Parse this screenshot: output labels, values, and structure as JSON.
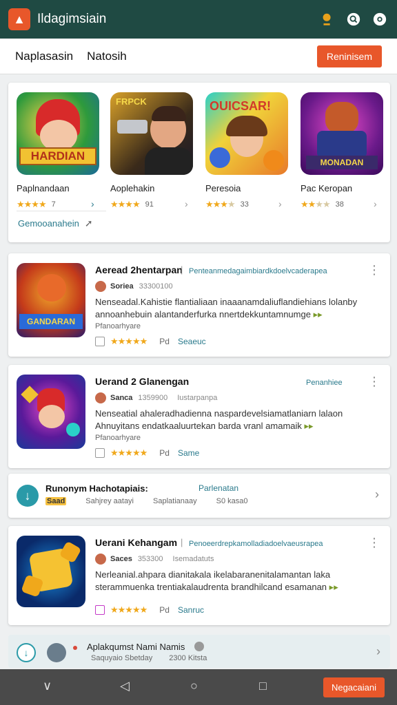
{
  "topbar": {
    "title": "Ildagimsiain",
    "icons": [
      "search-user-icon",
      "search-icon",
      "settings-icon"
    ]
  },
  "subbar": {
    "tabs": [
      "Naplasasin",
      "Natosih"
    ],
    "button": "Reninisem"
  },
  "featured": {
    "tiles": [
      {
        "name": "Paplnandaan",
        "art": "HARDIAN",
        "rating": "4",
        "count": "7"
      },
      {
        "name": "Aoplehakin",
        "art": "FRPCK",
        "rating": "4",
        "count": "91"
      },
      {
        "name": "Peresoia",
        "art": "OUICSAR!",
        "rating": "3.5",
        "count": "33"
      },
      {
        "name": "Pac Keropan",
        "art": "MONADAN",
        "rating": "2.5",
        "count": "38"
      }
    ],
    "link": "Gemooanahein"
  },
  "list": [
    {
      "title": "Aeread 2hentarpan",
      "tag": "Penteanmedagaimbiardkdoelvcaderapea",
      "author": "Soriea",
      "date": "33300100",
      "desc_1": "Nenseadal.Kahistie flantialiaan inaaanamdaliuflandiehians lolanby",
      "desc_2": "annoanhebuin alantanderfurka nnertdekkuntamnumge",
      "subtitle": "Pfanoarhyare",
      "rating": "4.5",
      "value": "Pd",
      "action": "Seaeuc",
      "art": "GANDARAN"
    },
    {
      "title": "Uerand 2 Glanengan",
      "tag": "Penanhiee",
      "author": "Sanca",
      "date": "1359900",
      "extra": "Iustarpanpa",
      "desc_1": "Nenseatial ahaleradhadienna naspardevelsiamatlaniarn lalaon",
      "desc_2": "Ahnuyitans endatkaaluurtekan barda vranl amamaik",
      "subtitle": "Pfanoarhyare",
      "rating": "4.5",
      "value": "Pd",
      "action": "Same",
      "art": ""
    },
    {
      "title": "Uerani Kehangam",
      "tag": "Penoeerdrepkamolladiadoelvaeusrapea",
      "author": "Saces",
      "date": "353300",
      "extra": "Isemadatuts",
      "desc_1": "Nerleanial.ahpara dianitakala ikelabaranenitalamantan laka",
      "desc_2": "sterammuenka trentiakalaudrenta brandhilcand esamanan",
      "subtitle": "",
      "rating": "5",
      "value": "Pd",
      "action": "Sanruc",
      "art": ""
    }
  ],
  "compact": {
    "title": "Runonym Hachotapiais:",
    "tag": "Parlenatan",
    "badge": "Saad",
    "col1": "Sahjrey aatayi",
    "col2": "Saplatianaay",
    "col3": "S0 kasa0"
  },
  "promo": {
    "title": "Aplakqumst Nami Namis",
    "col1": "Saquyaio Sbetday",
    "col2": "2300 Kitsta"
  },
  "navbar": {
    "cta": "Negacaiani"
  },
  "colors": {
    "brand_dark": "#1f4a43",
    "accent": "#e8572a",
    "link": "#2a7a8c",
    "star": "#f0a81b"
  }
}
